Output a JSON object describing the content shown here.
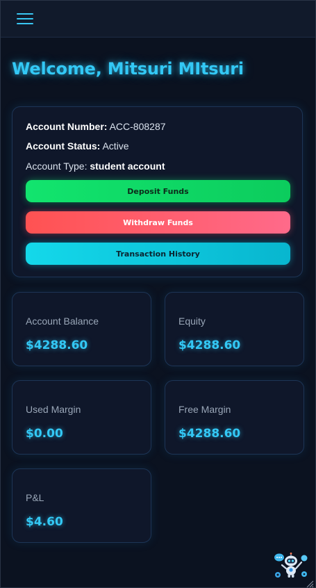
{
  "welcome": {
    "prefix": "Welcome, ",
    "name": "Mitsuri MItsuri"
  },
  "account": {
    "number_label": "Account Number:",
    "number_value": "ACC-808287",
    "status_label": "Account Status:",
    "status_value": "Active",
    "type_label": "Account Type:",
    "type_value": "student account"
  },
  "actions": {
    "deposit": "Deposit Funds",
    "withdraw": "Withdraw Funds",
    "history": "Transaction History"
  },
  "stats": {
    "balance": {
      "label": "Account Balance",
      "value": "$4288.60"
    },
    "equity": {
      "label": "Equity",
      "value": "$4288.60"
    },
    "used_margin": {
      "label": "Used Margin",
      "value": "$0.00"
    },
    "free_margin": {
      "label": "Free Margin",
      "value": "$4288.60"
    },
    "pnl": {
      "label": "P&L",
      "value": "$4.60"
    }
  },
  "icons": {
    "menu": "hamburger-menu-icon",
    "assistant": "robot-assistant-icon",
    "resize": "resize-grip-icon"
  },
  "colors": {
    "accent": "#33c8f5",
    "deposit": "#12e46e",
    "withdraw": "#ff5a6e",
    "history": "#14d8ea",
    "background": "#0b1220",
    "card": "#0f172a"
  }
}
